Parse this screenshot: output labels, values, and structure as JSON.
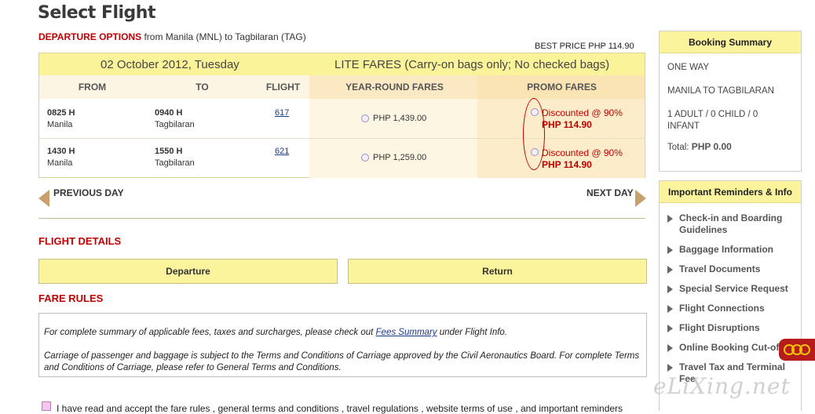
{
  "page": {
    "title": "Select Flight"
  },
  "departure": {
    "heading": "DEPARTURE OPTIONS",
    "route_text": "from Manila (MNL) to Tagbilaran (TAG)",
    "best_price": "BEST PRICE PHP  114.90"
  },
  "flight_table": {
    "date": "02 October 2012, Tuesday",
    "fare_banner": "LITE FARES (Carry-on bags only; No checked bags)",
    "headers": [
      "FROM",
      "TO",
      "FLIGHT",
      "YEAR-ROUND FARES",
      "PROMO FARES"
    ],
    "rows": [
      {
        "from_time": "0825 H",
        "from_city": "Manila",
        "to_time": "0940 H",
        "to_city": "Tagbilaran",
        "flight": "617",
        "year_round": "PHP  1,439.00",
        "promo_label": "Discounted @ 90%",
        "promo_price": "PHP  114.90"
      },
      {
        "from_time": "1430 H",
        "from_city": "Manila",
        "to_time": "1550 H",
        "to_city": "Tagbilaran",
        "flight": "621",
        "year_round": "PHP  1,259.00",
        "promo_label": "Discounted @ 90%",
        "promo_price": "PHP  114.90"
      }
    ]
  },
  "day_nav": {
    "previous": "PREVIOUS DAY",
    "next": "NEXT DAY"
  },
  "flight_details": {
    "heading": "FLIGHT DETAILS",
    "departure_btn": "Departure",
    "return_btn": "Return"
  },
  "fare_rules": {
    "heading": "FARE RULES",
    "line1_pre": "For complete summary of applicable fees, taxes and surcharges, please check out ",
    "line1_link": "Fees Summary",
    "line1_post": " under Flight Info.",
    "line2": "Carriage of passenger and baggage is subject to the Terms and Conditions of Carriage approved by the Civil Aeronautics Board. For complete Terms and Conditions of Carriage, please refer to General Terms and Conditions."
  },
  "accept": {
    "text": "I have read and accept the fare rules , general terms and conditions , travel regulations , website terms of use , and important reminders"
  },
  "booking_summary": {
    "title": "Booking Summary",
    "trip_type": "ONE WAY",
    "route": "MANILA TO TAGBILARAN",
    "pax_line1": "1 ADULT / 0 CHILD / 0",
    "pax_line2": "INFANT",
    "total_label": "Total:",
    "total_value": "PHP 0.00"
  },
  "reminders": {
    "title": "Important Reminders & Info",
    "items": [
      "Check-in and Boarding Guidelines",
      "Baggage Information",
      "Travel Documents",
      "Special Service Request",
      "Flight Connections",
      "Flight Disruptions",
      "Online Booking Cut-off",
      "Travel Tax and Terminal Fee"
    ]
  },
  "watermark": "eLiXing.net",
  "colors": {
    "accent_red": "#c00000",
    "banner_yellow": "#fbf39a",
    "button_yellow": "#fcf49c"
  }
}
